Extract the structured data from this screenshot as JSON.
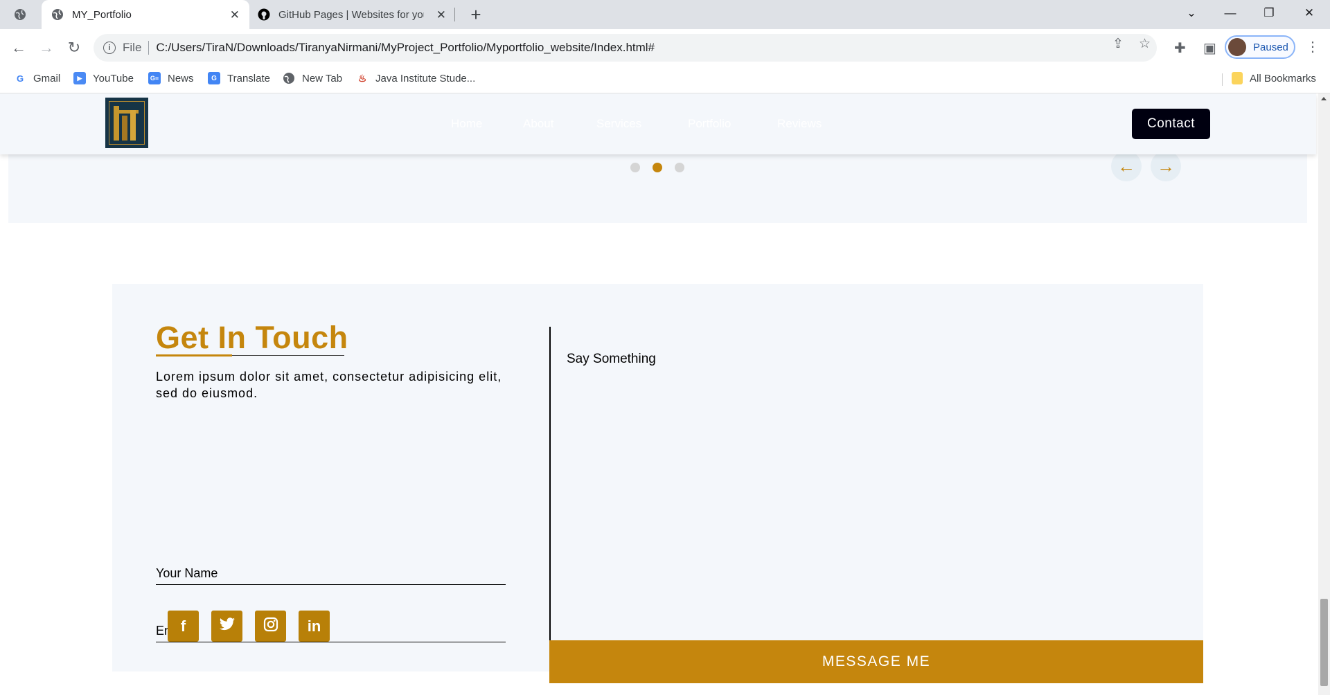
{
  "browser": {
    "tabs": [
      {
        "title": "MY_Portfolio",
        "active": true
      },
      {
        "title": "GitHub Pages | Websites for you",
        "active": false
      }
    ],
    "address": {
      "scheme_label": "File",
      "url": "C:/Users/TiraN/Downloads/TiranyaNirmani/MyProject_Portfolio/Myportfolio_website/Index.html#"
    },
    "profile_label": "Paused",
    "bookmarks": [
      {
        "label": "Gmail",
        "icon": "google-icon"
      },
      {
        "label": "YouTube",
        "icon": "youtube-icon"
      },
      {
        "label": "News",
        "icon": "news-icon"
      },
      {
        "label": "Translate",
        "icon": "translate-icon"
      },
      {
        "label": "New Tab",
        "icon": "globe-icon"
      },
      {
        "label": "Java Institute Stude...",
        "icon": "java-icon"
      }
    ],
    "all_bookmarks_label": "All Bookmarks"
  },
  "site": {
    "nav": [
      "Home",
      "About",
      "Services",
      "Portfolio",
      "Reviews"
    ],
    "contact_button": "Contact",
    "carousel": {
      "slide_count": 3,
      "active_index": 1
    }
  },
  "contact": {
    "title": "Get In Touch",
    "description": "Lorem ipsum dolor sit amet, consectetur adipisicing elit, sed do eiusmod.",
    "name_placeholder": "Your Name",
    "email_placeholder": "Email",
    "message_placeholder": "Say Something",
    "submit_label": "MESSAGE ME",
    "socials": [
      "facebook-icon",
      "twitter-icon",
      "instagram-icon",
      "linkedin-icon"
    ]
  },
  "colors": {
    "accent": "#c5860d",
    "section_bg": "#f4f7fb",
    "button_dark": "#000010"
  }
}
